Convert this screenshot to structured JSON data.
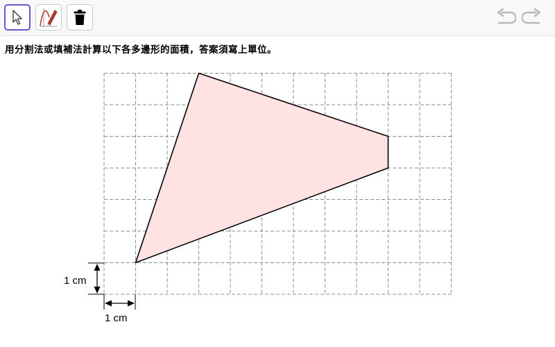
{
  "toolbar": {
    "tools": [
      {
        "icon": "move-arrow-icon",
        "active": true
      },
      {
        "icon": "pen-icon",
        "active": false
      },
      {
        "icon": "trash-icon",
        "active": false
      }
    ],
    "history": {
      "undo_icon": "undo-icon",
      "redo_icon": "redo-icon"
    }
  },
  "question": {
    "instruction": "用分割法或填補法計算以下各多邊形的面積，答案須寫上單位。"
  },
  "figure": {
    "grid": {
      "columns": 11,
      "rows": 7,
      "line_style": "dashed",
      "line_color": "#8c8c8c"
    },
    "polygon": {
      "vertices": [
        [
          1,
          1
        ],
        [
          3,
          7
        ],
        [
          9,
          5
        ],
        [
          9,
          4
        ]
      ],
      "fill": "#ffe3e3",
      "stroke": "#000000"
    },
    "scale_labels": {
      "vertical": "1 cm",
      "horizontal": "1 cm"
    }
  },
  "colors": {
    "accent": "#6557d2",
    "history_icons": "#b9b9b9"
  }
}
